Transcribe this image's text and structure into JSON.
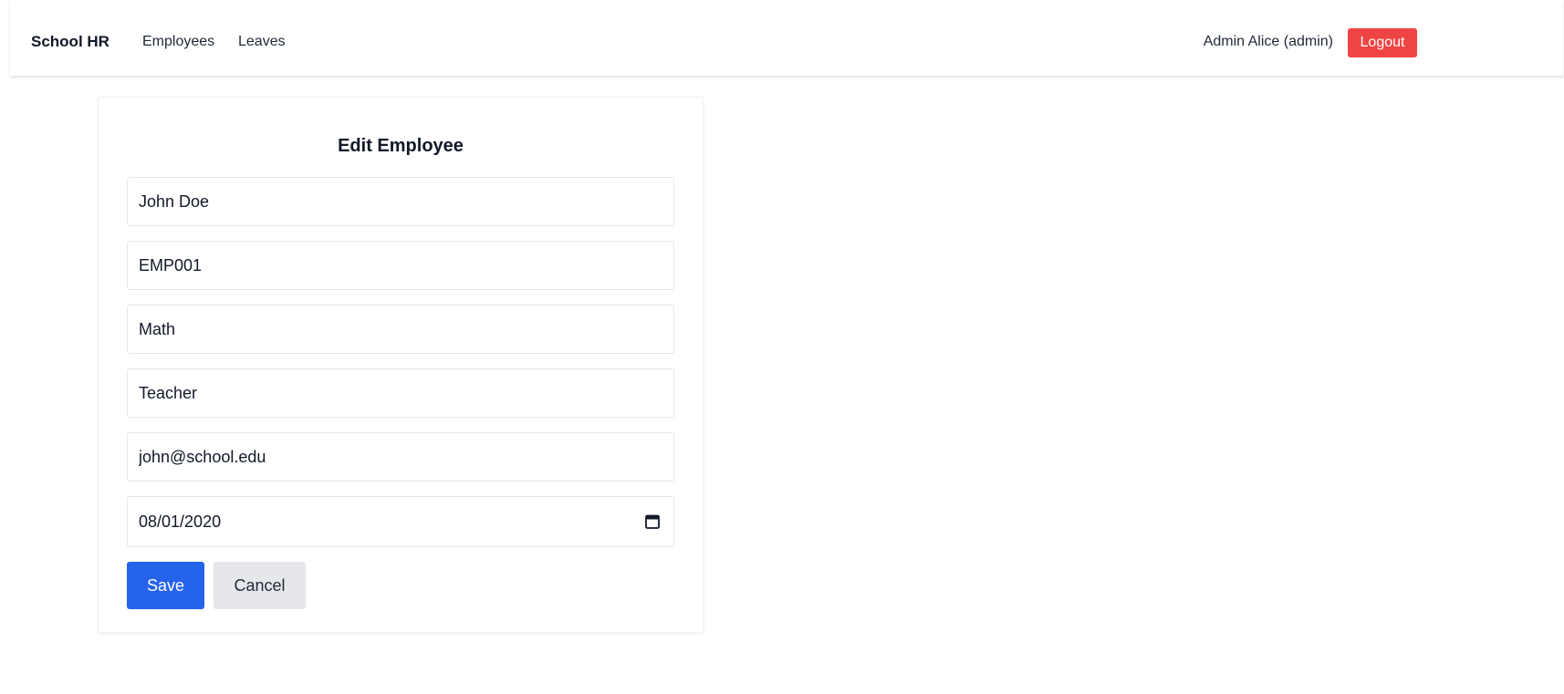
{
  "navbar": {
    "brand": "School HR",
    "links": [
      "Employees",
      "Leaves"
    ],
    "user": "Admin Alice (admin)",
    "logout_label": "Logout"
  },
  "form": {
    "title": "Edit Employee",
    "name": "John Doe",
    "employee_id": "EMP001",
    "department": "Math",
    "role": "Teacher",
    "email": "john@school.edu",
    "join_date": "08/01/2020",
    "save_label": "Save",
    "cancel_label": "Cancel"
  },
  "colors": {
    "primary": "#2563eb",
    "danger": "#ef4444",
    "secondary": "#e5e7eb"
  },
  "icons": {
    "date_picker": "calendar-icon"
  }
}
